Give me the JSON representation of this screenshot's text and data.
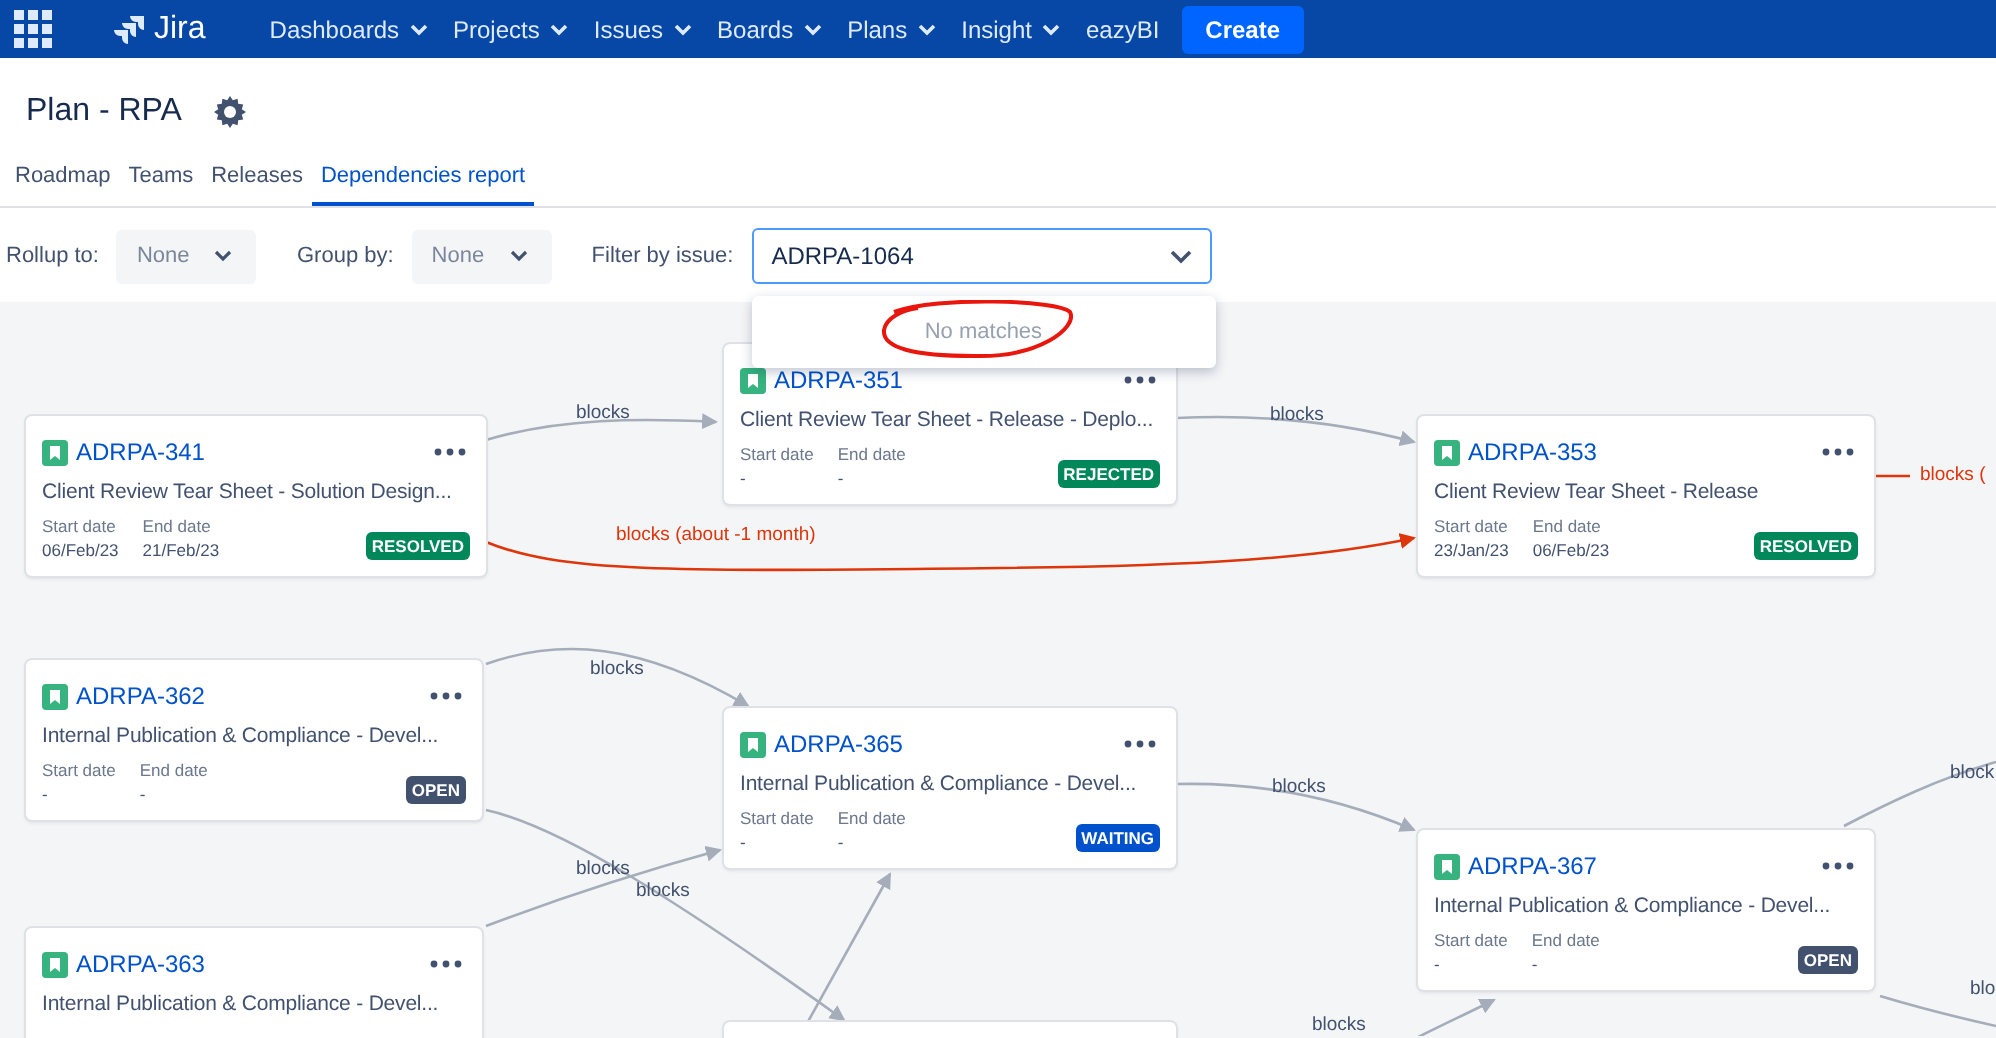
{
  "nav": {
    "items": [
      {
        "label": "Dashboards",
        "has_menu": true
      },
      {
        "label": "Projects",
        "has_menu": true
      },
      {
        "label": "Issues",
        "has_menu": true
      },
      {
        "label": "Boards",
        "has_menu": true
      },
      {
        "label": "Plans",
        "has_menu": true
      },
      {
        "label": "Insight",
        "has_menu": true
      },
      {
        "label": "eazyBI",
        "has_menu": false
      }
    ],
    "logo": "Jira",
    "create": "Create"
  },
  "page": {
    "title": "Plan - RPA"
  },
  "tabs": [
    {
      "label": "Roadmap",
      "selected": false
    },
    {
      "label": "Teams",
      "selected": false
    },
    {
      "label": "Releases",
      "selected": false
    },
    {
      "label": "Dependencies report",
      "selected": true
    }
  ],
  "filters": {
    "rollup_label": "Rollup to:",
    "rollup_value": "None",
    "group_label": "Group by:",
    "group_value": "None",
    "issue_label": "Filter by issue:",
    "issue_value": "ADRPA-1064",
    "dropdown_message": "No matches",
    "message_circled": true
  },
  "cards": [
    {
      "key": "ADRPA-341",
      "title": "Client Review Tear Sheet - Solution Design...",
      "start_label": "Start date",
      "start": "06/Feb/23",
      "end_label": "End date",
      "end": "21/Feb/23",
      "status": "RESOLVED",
      "color": "#00875a",
      "kind": "issue"
    },
    {
      "key": "ADRPA-351",
      "title": "Client Review Tear Sheet - Release - Deplo...",
      "start_label": "Start date",
      "start": "-",
      "end_label": "End date",
      "end": "-",
      "status": "REJECTED",
      "color": "#00875a",
      "kind": "issue"
    },
    {
      "key": "ADRPA-353",
      "title": "Client Review Tear Sheet - Release",
      "start_label": "Start date",
      "start": "23/Jan/23",
      "end_label": "End date",
      "end": "06/Feb/23",
      "status": "RESOLVED",
      "color": "#00875a",
      "kind": "issue"
    },
    {
      "key": "ADRPA-362",
      "title": "Internal Publication & Compliance - Devel...",
      "start_label": "Start date",
      "start": "-",
      "end_label": "End date",
      "end": "-",
      "status": "OPEN",
      "color": "#42526e",
      "kind": "issue"
    },
    {
      "key": "ADRPA-365",
      "title": "Internal Publication & Compliance - Devel...",
      "start_label": "Start date",
      "start": "-",
      "end_label": "End date",
      "end": "-",
      "status": "WAITING",
      "color": "#0052cc",
      "kind": "issue"
    },
    {
      "key": "ADRPA-367",
      "title": "Internal Publication & Compliance - Devel...",
      "start_label": "Start date",
      "start": "-",
      "end_label": "End date",
      "end": "-",
      "status": "OPEN",
      "color": "#42526e",
      "kind": "issue"
    },
    {
      "key": "ADRPA-363",
      "title": "Internal Publication & Compliance - Devel...",
      "kind": "issue"
    },
    {
      "kind": "stub"
    }
  ],
  "edges": [
    {
      "label": "blocks",
      "kind": "normal"
    },
    {
      "label": "blocks",
      "kind": "normal"
    },
    {
      "label": "blocks (about -1 month)",
      "kind": "late"
    },
    {
      "label": "blocks (",
      "kind": "late"
    },
    {
      "label": "blocks",
      "kind": "normal"
    },
    {
      "label": "blocks",
      "kind": "normal"
    },
    {
      "label": "blocks",
      "kind": "normal"
    },
    {
      "label": "blocks",
      "kind": "normal"
    },
    {
      "kind": "normal"
    },
    {
      "label": "block",
      "kind": "normal"
    },
    {
      "label": "blo",
      "kind": "normal"
    },
    {
      "label": "blocks",
      "kind": "normal"
    }
  ]
}
